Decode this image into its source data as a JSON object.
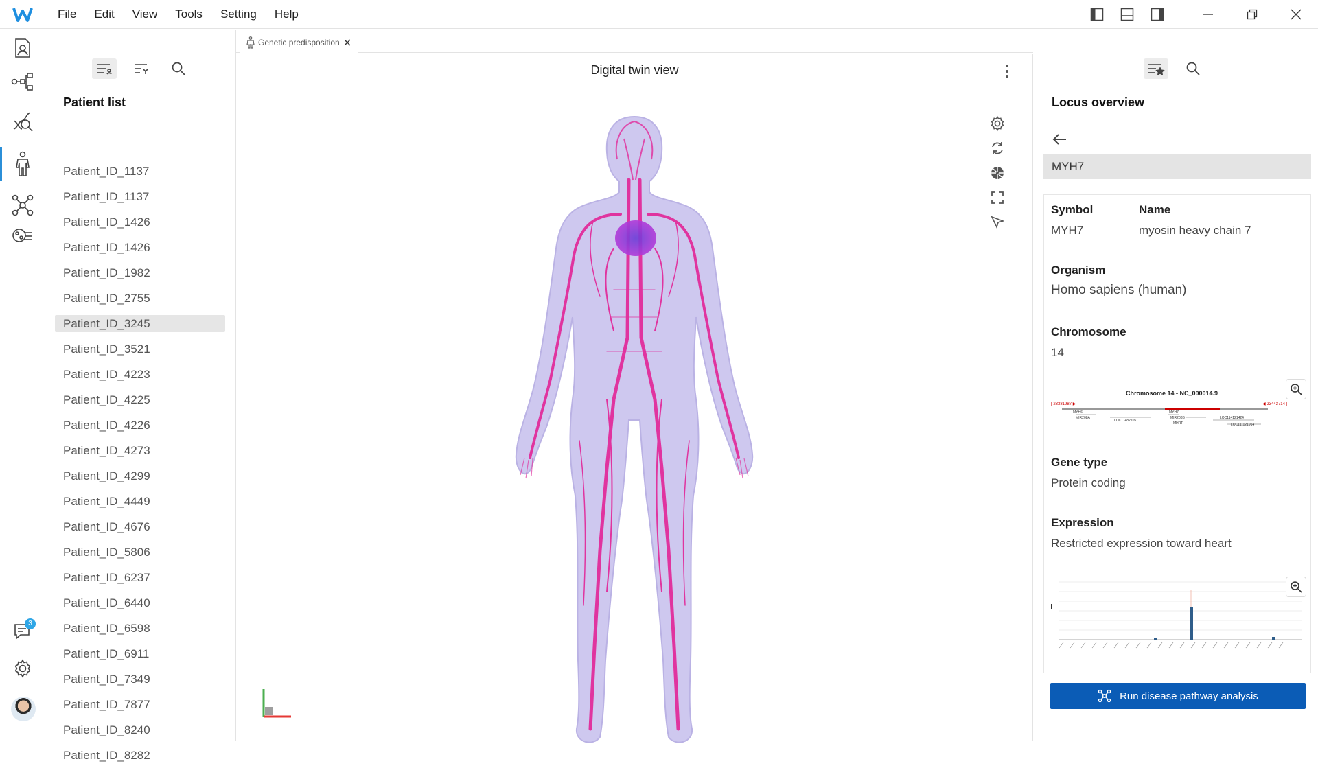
{
  "menu": [
    "File",
    "Edit",
    "View",
    "Tools",
    "Setting",
    "Help"
  ],
  "rail": {
    "notifications_count": "3"
  },
  "patient_panel": {
    "title": "Patient list",
    "items": [
      "Patient_ID_1137",
      "Patient_ID_1137",
      "Patient_ID_1426",
      "Patient_ID_1426",
      "Patient_ID_1982",
      "Patient_ID_2755",
      "Patient_ID_3245",
      "Patient_ID_3521",
      "Patient_ID_4223",
      "Patient_ID_4225",
      "Patient_ID_4226",
      "Patient_ID_4273",
      "Patient_ID_4299",
      "Patient_ID_4449",
      "Patient_ID_4676",
      "Patient_ID_5806",
      "Patient_ID_6237",
      "Patient_ID_6440",
      "Patient_ID_6598",
      "Patient_ID_6911",
      "Patient_ID_7349",
      "Patient_ID_7877",
      "Patient_ID_8240",
      "Patient_ID_8282"
    ],
    "selected_index": 6
  },
  "tab": {
    "label": "Genetic predisposition"
  },
  "viewer": {
    "title": "Digital twin view"
  },
  "locus": {
    "title": "Locus overview",
    "gene": "MYH7",
    "symbol_label": "Symbol",
    "symbol_value": "MYH7",
    "name_label": "Name",
    "name_value": "myosin heavy chain 7",
    "organism_label": "Organism",
    "organism_value": "Homo sapiens (human)",
    "chromosome_label": "Chromosome",
    "chromosome_value": "14",
    "chromosome_map_title": "Chromosome 14 - NC_000014.9",
    "gene_type_label": "Gene type",
    "gene_type_value": "Protein coding",
    "expression_label": "Expression",
    "expression_value": "Restricted expression toward heart"
  },
  "run_button": {
    "label": "Run disease pathway analysis"
  },
  "colors": {
    "accent": "#0b5cb6",
    "rail_active": "#2b8fd8",
    "vessel": "#e0349f",
    "body": "#c9c3ee"
  }
}
